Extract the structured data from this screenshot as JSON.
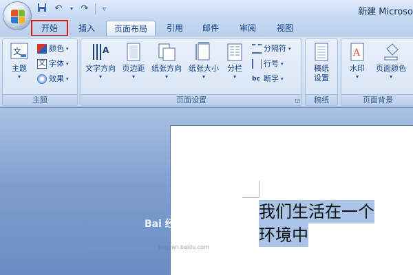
{
  "window": {
    "title": "新建 Microso"
  },
  "tabs": [
    {
      "label": "开始"
    },
    {
      "label": "插入"
    },
    {
      "label": "页面布局"
    },
    {
      "label": "引用"
    },
    {
      "label": "邮件"
    },
    {
      "label": "审阅"
    },
    {
      "label": "视图"
    }
  ],
  "active_tab": "页面布局",
  "highlighted_tab": "开始",
  "ribbon": {
    "themes": {
      "label": "主题",
      "theme_button": "主题",
      "colors": "颜色",
      "fonts": "字体",
      "effects": "效果",
      "icon_text": "文"
    },
    "page_setup": {
      "label": "页面设置",
      "text_direction": "文字方向",
      "margins": "页边距",
      "orientation": "纸张方向",
      "size": "纸张大小",
      "columns": "分栏",
      "breaks": "分隔符",
      "line_numbers": "行号",
      "hyphenation": "断字"
    },
    "draft_paper": {
      "label": "稿纸",
      "button_line1": "稿纸",
      "button_line2": "设置"
    },
    "page_background": {
      "label": "页面背景",
      "watermark": "水印",
      "page_color": "页面颜色"
    }
  },
  "document": {
    "lines": [
      "我们生活在一个",
      "环境中"
    ]
  },
  "overlay_watermark": {
    "text": "Bai 经验",
    "sub": "jingyan.baidu.com"
  },
  "colors": {
    "highlight_box": "#e01818",
    "selection": "#a9c4e6",
    "ribbon_text": "#15428b"
  }
}
